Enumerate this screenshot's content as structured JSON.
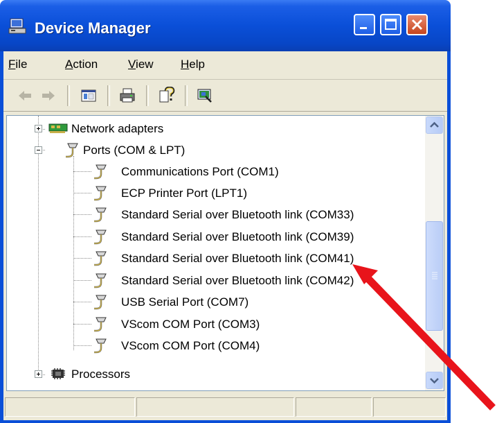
{
  "window": {
    "title": "Device Manager"
  },
  "menu": [
    {
      "label": "File",
      "accel": "F",
      "rest": "ile"
    },
    {
      "label": "Action",
      "accel": "A",
      "rest": "ction"
    },
    {
      "label": "View",
      "accel": "V",
      "rest": "iew"
    },
    {
      "label": "Help",
      "accel": "H",
      "rest": "elp"
    }
  ],
  "toolbar": {
    "buttons": [
      "back-icon",
      "forward-icon",
      "show-hide-console-tree-icon",
      "print-icon",
      "help-icon",
      "scan-hardware-icon"
    ]
  },
  "tree": {
    "network_adapters": "Network adapters",
    "ports": "Ports (COM & LPT)",
    "port_items": [
      "Communications Port (COM1)",
      "ECP Printer Port (LPT1)",
      "Standard Serial over Bluetooth link (COM33)",
      "Standard Serial over Bluetooth link (COM39)",
      "Standard Serial over Bluetooth link (COM41)",
      "Standard Serial over Bluetooth link (COM42)",
      "USB Serial Port (COM7)",
      "VScom COM Port (COM3)",
      "VScom COM Port (COM4)"
    ],
    "processors": "Processors"
  },
  "colors": {
    "titlebar": "#0a4fd8",
    "face": "#ece9d8",
    "annotation_arrow": "#e8141b"
  }
}
